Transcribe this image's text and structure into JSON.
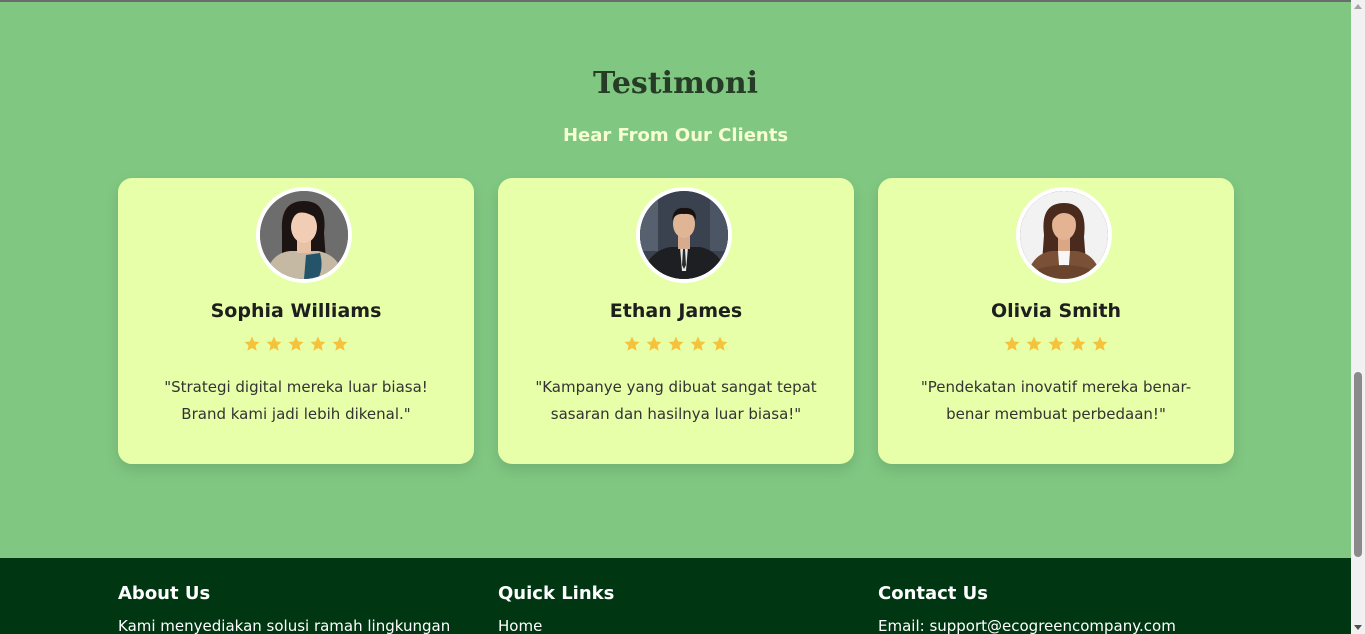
{
  "testimonials": {
    "title": "Testimoni",
    "subtitle": "Hear From Our Clients",
    "rating_color": "#f5c33b",
    "items": [
      {
        "name": "Sophia Williams",
        "rating": 5,
        "quote": "\"Strategi digital mereka luar biasa! Brand kami jadi lebih dikenal.\"",
        "avatar": "woman-portrait-avatar"
      },
      {
        "name": "Ethan James",
        "rating": 5,
        "quote": "\"Kampanye yang dibuat sangat tepat sasaran dan hasilnya luar biasa!\"",
        "avatar": "man-portrait-avatar"
      },
      {
        "name": "Olivia Smith",
        "rating": 5,
        "quote": "\"Pendekatan inovatif mereka benar-benar membuat perbedaan!\"",
        "avatar": "woman-portrait-avatar"
      }
    ]
  },
  "footer": {
    "about": {
      "heading": "About Us",
      "text": "Kami menyediakan solusi ramah lingkungan"
    },
    "quick_links": {
      "heading": "Quick Links",
      "items": [
        "Home"
      ]
    },
    "contact": {
      "heading": "Contact Us",
      "email": "Email: support@ecogreencompany.com"
    }
  },
  "colors": {
    "section_bg": "#80c882",
    "card_bg": "#e6ffa8",
    "footer_bg": "#003612",
    "subtitle": "#f6ffd0"
  }
}
